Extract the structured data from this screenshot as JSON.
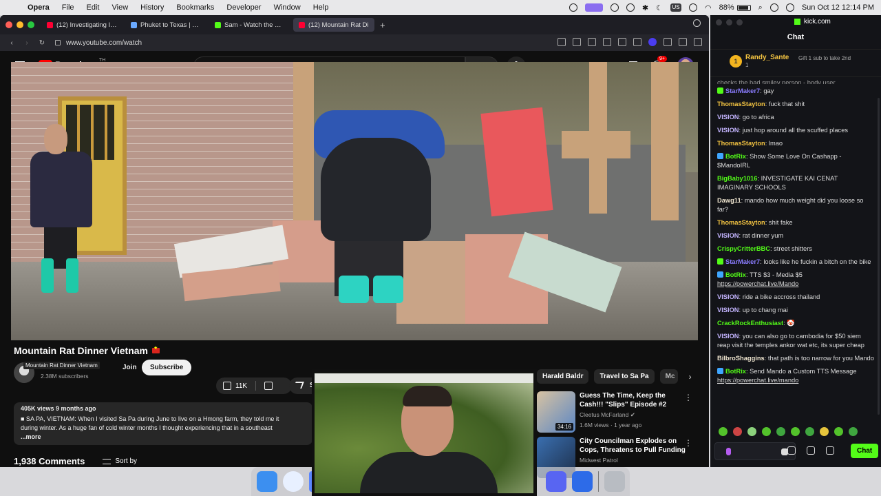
{
  "menubar": {
    "app": "Opera",
    "items": [
      "File",
      "Edit",
      "View",
      "History",
      "Bookmarks",
      "Developer",
      "Window",
      "Help"
    ],
    "battery": "88%",
    "clock": "Sun Oct 12  12:14 PM",
    "input_source": "US"
  },
  "browser": {
    "tabs": [
      {
        "label": "(12) Investigating Israeli",
        "color": "#ff0033"
      },
      {
        "label": "Phuket to Texas | Explor",
        "color": "#6aa9ff"
      },
      {
        "label": "Sam - Watch the VOD o",
        "color": "#53fc18"
      },
      {
        "label": "(12) Mountain Rat Di",
        "color": "#ff0033",
        "active": true
      }
    ],
    "url": "www.youtube.com/watch"
  },
  "youtube": {
    "logo": "Premium",
    "logo_sup": "TH",
    "search_placeholder": "Search",
    "notif_count": "9+",
    "video_title": "Mountain Rat Dinner Vietnam",
    "channel_name": "Mountain Rat Dinner Vietnam",
    "subscribers": "2.38M subscribers",
    "join": "Join",
    "subscribe": "Subscribe",
    "likes": "11K",
    "share": "S",
    "desc_meta": "405K views  9 months ago",
    "desc_line1": "■ SA PA, VIETNAM: When I visited Sa Pa during June to live on a Hmong farm, they told me it",
    "desc_line2": "during winter. As a huge fan of cold winter months I thought experiencing that in a southeast",
    "desc_more": "...more",
    "comments": "1,938 Comments",
    "sort_by": "Sort by",
    "chips": [
      "Harald Baldr",
      "Travel to Sa Pa",
      "Mc"
    ],
    "recs": [
      {
        "title": "Guess The Time, Keep the Cash!!! \"Slips\" Episode #2",
        "channel": "Cleetus McFarland ✔",
        "meta": "1.6M views · 1 year ago",
        "duration": "34:16"
      },
      {
        "title": "City Councilman Explodes on Cops, Threatens to Pull Funding",
        "channel": "Midwest Patrol",
        "meta": "",
        "duration": ""
      }
    ]
  },
  "kick": {
    "site": "kick.com",
    "title": "Chat",
    "gift_rank": "1",
    "gift_user": "Randy_Sante",
    "gift_count": "1",
    "gift_cta": "Gift 1 sub to take 2nd",
    "partial_line": "checks the bad smiley person - body user",
    "messages": [
      {
        "user": "StarMaker7",
        "color": "#8a7cff",
        "badge": "#53fc18",
        "text": "gay"
      },
      {
        "user": "ThomasStayton",
        "color": "#f5c542",
        "badge": "",
        "text": "fuck that shit"
      },
      {
        "user": "VISION",
        "color": "#c4b5ff",
        "badge": "",
        "text": "go to africa"
      },
      {
        "user": "VISION",
        "color": "#c4b5ff",
        "badge": "",
        "text": "just hop around all the scuffed places"
      },
      {
        "user": "ThomasStayton",
        "color": "#f5c542",
        "badge": "",
        "text": "lmao"
      },
      {
        "user": "BotRix",
        "color": "#53fc18",
        "badge": "#3fa6ff",
        "text": "Show Some Love On Cashapp - $MandoIRL"
      },
      {
        "user": "BigBaby1016",
        "color": "#53fc18",
        "badge": "",
        "text": "INVESTIGATE KAI CENAT IMAGINARY SCHOOLS"
      },
      {
        "user": "Dawg11",
        "color": "#f0e6d0",
        "badge": "",
        "text": "mando how much weight did you loose so far?"
      },
      {
        "user": "ThomasStayton",
        "color": "#f5c542",
        "badge": "",
        "text": "shit fake"
      },
      {
        "user": "VISION",
        "color": "#c4b5ff",
        "badge": "",
        "text": "rat dinner yum"
      },
      {
        "user": "CrispyCritterBBC",
        "color": "#53fc18",
        "badge": "",
        "text": "street shitters"
      },
      {
        "user": "StarMaker7",
        "color": "#8a7cff",
        "badge": "#53fc18",
        "text": "looks like he fuckin a bitch on the bike"
      },
      {
        "user": "BotRix",
        "color": "#53fc18",
        "badge": "#3fa6ff",
        "text": "TTS $3 - Media $5",
        "link": "https://powerchat.live/Mando"
      },
      {
        "user": "VISION",
        "color": "#c4b5ff",
        "badge": "",
        "text": "ride a bike accross thailand"
      },
      {
        "user": "VISION",
        "color": "#c4b5ff",
        "badge": "",
        "text": "up to chang mai"
      },
      {
        "user": "CrackRockEnthusiast",
        "color": "#53fc18",
        "badge": "",
        "text": "🤡"
      },
      {
        "user": "VISION",
        "color": "#c4b5ff",
        "badge": "",
        "text": "you can also go to cambodia for $50 siem reap visit the temples ankor wat etc, its super cheap"
      },
      {
        "user": "BilbroShaggins",
        "color": "#f0e6d0",
        "badge": "",
        "text": "that path is too narrow for you Mando"
      },
      {
        "user": "BotRix",
        "color": "#53fc18",
        "badge": "#3fa6ff",
        "text": "Send Mando a Custom TTS Message",
        "link": "https://powerchat.live/mando"
      }
    ],
    "send": "Chat"
  }
}
